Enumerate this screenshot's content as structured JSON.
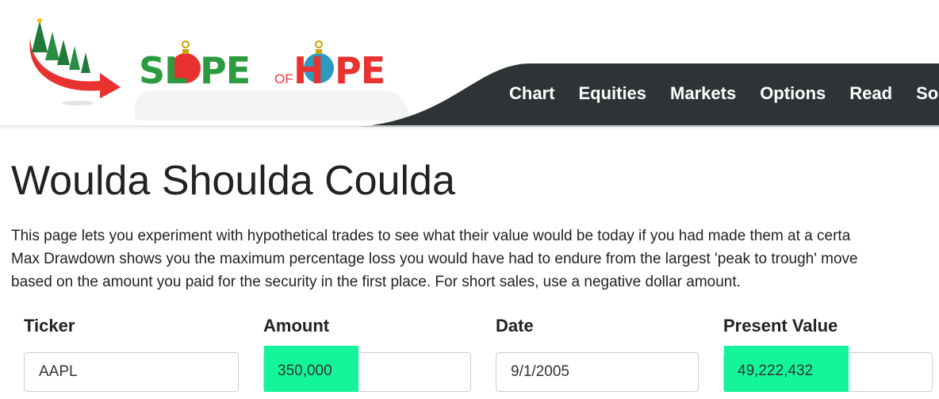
{
  "header": {
    "logo": {
      "text_parts": [
        "SL",
        "O",
        "PE",
        "OF",
        "H",
        "O",
        "PE"
      ],
      "alt": "SLOPE OF HOPE"
    },
    "nav": [
      "Chart",
      "Equities",
      "Markets",
      "Options",
      "Read",
      "So"
    ],
    "nav_bg_color": "#2e3335"
  },
  "page": {
    "title": "Woulda Shoulda Coulda",
    "intro_lines": [
      "This page lets you experiment with hypothetical trades to see what their value would be today if you had made them at a certa",
      "Max Drawdown shows you the maximum percentage loss you would have had to endure from the largest 'peak to trough' move",
      "based on the amount you paid for the security in the first place. For short sales, use a negative dollar amount."
    ]
  },
  "form": {
    "ticker_label": "Ticker",
    "ticker_value": "AAPL",
    "amount_label": "Amount",
    "amount_value": "350,000",
    "date_label": "Date",
    "date_value": "9/1/2005",
    "present_value_label": "Present Value",
    "present_value": "49,222,432",
    "highlight_color": "#14f59a"
  }
}
